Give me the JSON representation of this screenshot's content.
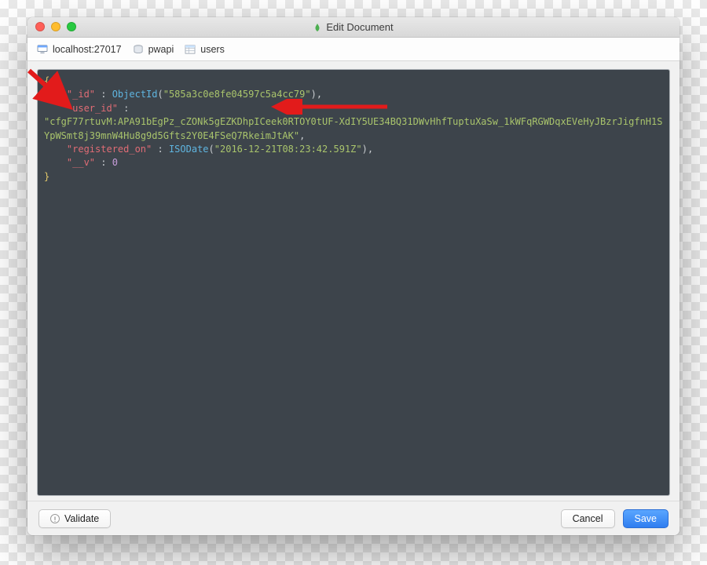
{
  "window": {
    "title": "Edit Document"
  },
  "breadcrumb": {
    "host": "localhost:27017",
    "database": "pwapi",
    "collection": "users"
  },
  "doc": {
    "open_brace": "{",
    "close_brace": "}",
    "id_key": "\"_id\"",
    "colon": " : ",
    "oid_fn": "ObjectId",
    "oid_open": "(",
    "oid_val": "\"585a3c0e8fe04597c5a4cc79\"",
    "oid_close": ")",
    "comma": ",",
    "user_key": "\"user_id\"",
    "user_val": "\"cfgF77rtuvM:APA91bEgPz_cZONk5gEZKDhpICeek0RTOY0tUF-XdIY5UE34BQ31DWvHhfTuptuXaSw_1kWFqRGWDqxEVeHyJBzrJigfnH1SYpWSmt8j39mnW4Hu8g9d5Gfts2Y0E4FSeQ7RkeimJtAK\"",
    "reg_key": "\"registered_on\"",
    "iso_fn": "ISODate",
    "iso_open": "(",
    "iso_val": "\"2016-12-21T08:23:42.591Z\"",
    "iso_close": ")",
    "v_key": "\"__v\"",
    "v_val": "0"
  },
  "buttons": {
    "validate": "Validate",
    "cancel": "Cancel",
    "save": "Save"
  }
}
